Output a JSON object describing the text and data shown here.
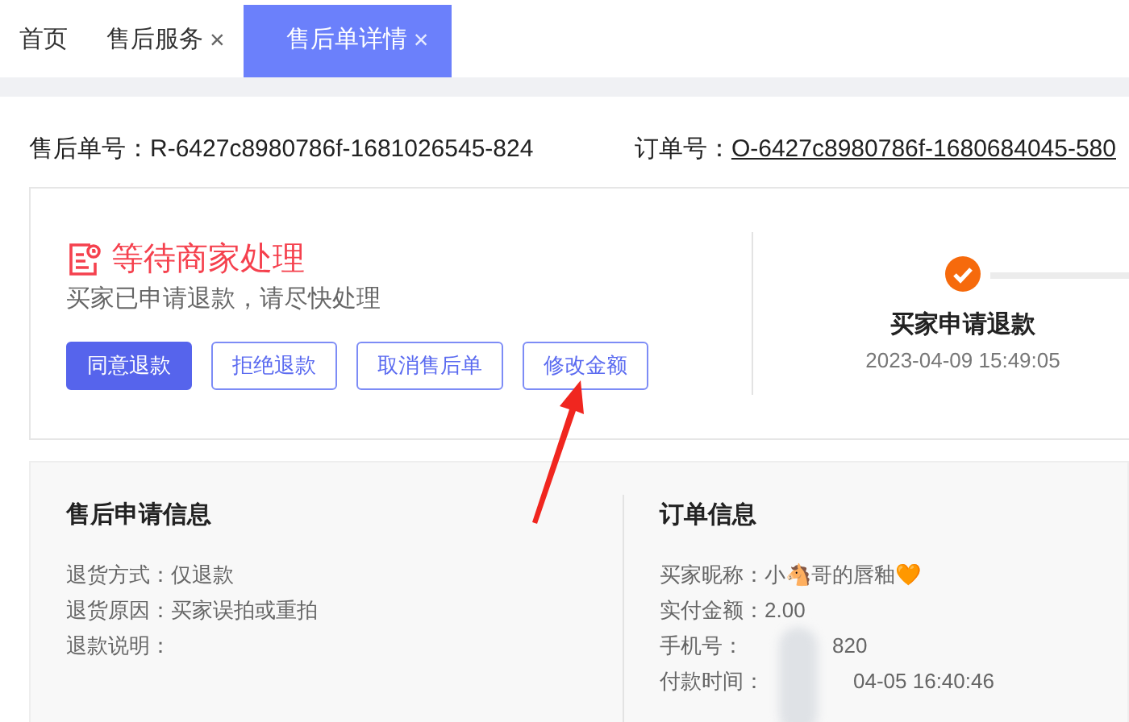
{
  "tabs": [
    {
      "label": "首页",
      "selected": false,
      "closable": false
    },
    {
      "label": "售后服务",
      "selected": false,
      "closable": true
    },
    {
      "label": "售后单详情",
      "selected": true,
      "closable": true
    }
  ],
  "close_glyph": "×",
  "header": {
    "after_sale_label": "售后单号：",
    "after_sale_no": "R-6427c8980786f-1681026545-824",
    "order_label": "订单号：",
    "order_no": "O-6427c8980786f-1680684045-580"
  },
  "status": {
    "title": "等待商家处理",
    "message": "买家已申请退款，请尽快处理"
  },
  "actions": [
    {
      "label": "同意退款",
      "kind": "primary"
    },
    {
      "label": "拒绝退款",
      "kind": "outline"
    },
    {
      "label": "取消售后单",
      "kind": "outline"
    },
    {
      "label": "修改金额",
      "kind": "outline"
    }
  ],
  "steps": [
    {
      "title": "买家申请退款",
      "time": "2023-04-09 15:49:05",
      "done": true
    }
  ],
  "after_sale_info": {
    "title": "售后申请信息",
    "rows": [
      {
        "label": "退货方式：",
        "value": "仅退款"
      },
      {
        "label": "退货原因：",
        "value": "买家误拍或重拍"
      },
      {
        "label": "退款说明：",
        "value": ""
      }
    ]
  },
  "order_info": {
    "title": "订单信息",
    "rows": [
      {
        "label": "买家昵称：",
        "value": "小🐴哥的唇釉🧡",
        "redacted": false
      },
      {
        "label": "实付金额：",
        "value": "2.00",
        "redacted": false
      },
      {
        "label": "手机号：",
        "value": "820",
        "redacted": true
      },
      {
        "label": "付款时间：",
        "value": "04-05 16:40:46",
        "redacted": true
      }
    ]
  }
}
